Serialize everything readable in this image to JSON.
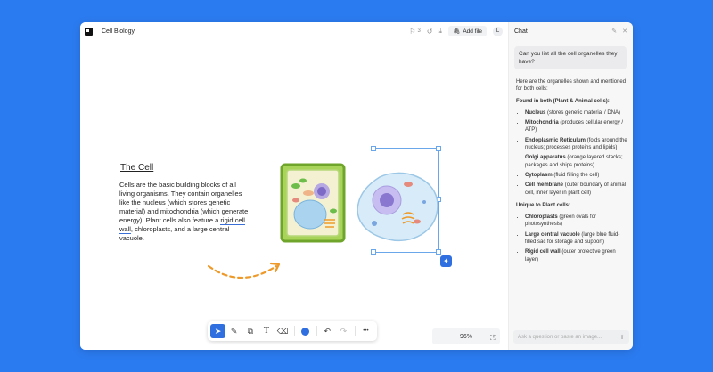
{
  "app": {
    "doc_title": "Cell Biology",
    "comments_count": "3",
    "add_file_label": "Add file",
    "avatar_initial": "L"
  },
  "canvas": {
    "title": "The Cell",
    "body_1": "Cells are the basic building blocks of all living organisms. They contain ",
    "link_1": "organelles",
    "body_2": " like the nucleus (which stores genetic material) and mitochondria (which generate energy). Plant cells also feature a ",
    "link_2": "rigid cell wall",
    "body_3": ", chloroplasts, and a large central vacuole."
  },
  "toolbar": {
    "tools": [
      "select-arrow-icon",
      "pencil-icon",
      "shapes-icon",
      "text-icon",
      "eraser-icon"
    ],
    "color": "#2f6fe0",
    "more_label": "•••"
  },
  "zoom": {
    "minus": "−",
    "value": "96%",
    "plus": "+"
  },
  "chat": {
    "title": "Chat",
    "user_message": "Can you list all the cell organelles they have?",
    "intro": "Here are the organelles shown and mentioned for both cells:",
    "section_both": "Found in both (Plant & Animal cells):",
    "both_items": [
      {
        "name": "Nucleus",
        "desc": " (stores genetic material / DNA)"
      },
      {
        "name": "Mitochondria",
        "desc": " (produces cellular energy / ATP)"
      },
      {
        "name": "Endoplasmic Reticulum",
        "desc": " (folds around the nucleus; processes proteins and lipids)"
      },
      {
        "name": "Golgi apparatus",
        "desc": " (orange layered stacks; packages and ships proteins)"
      },
      {
        "name": "Cytoplasm",
        "desc": " (fluid filling the cell)"
      },
      {
        "name": "Cell membrane",
        "desc": " (outer boundary of animal cell, inner layer in plant cell)"
      }
    ],
    "section_plant": "Unique to Plant cells:",
    "plant_items": [
      {
        "name": "Chloroplasts",
        "desc": " (green ovals for photosynthesis)"
      },
      {
        "name": "Large central vacuole",
        "desc": " (large blue fluid-filled sac for storage and support)"
      },
      {
        "name": "Rigid cell wall",
        "desc": " (outer protective green layer)"
      }
    ],
    "input_placeholder": "Ask a question or paste an image..."
  },
  "colors": {
    "background": "#2b7bf0",
    "accent": "#2f6fe0",
    "plant_wall": "#8ac23f",
    "animal_cell": "#cfe6f5",
    "nucleus": "#8e7fd0",
    "arrow": "#ee9a2a"
  }
}
